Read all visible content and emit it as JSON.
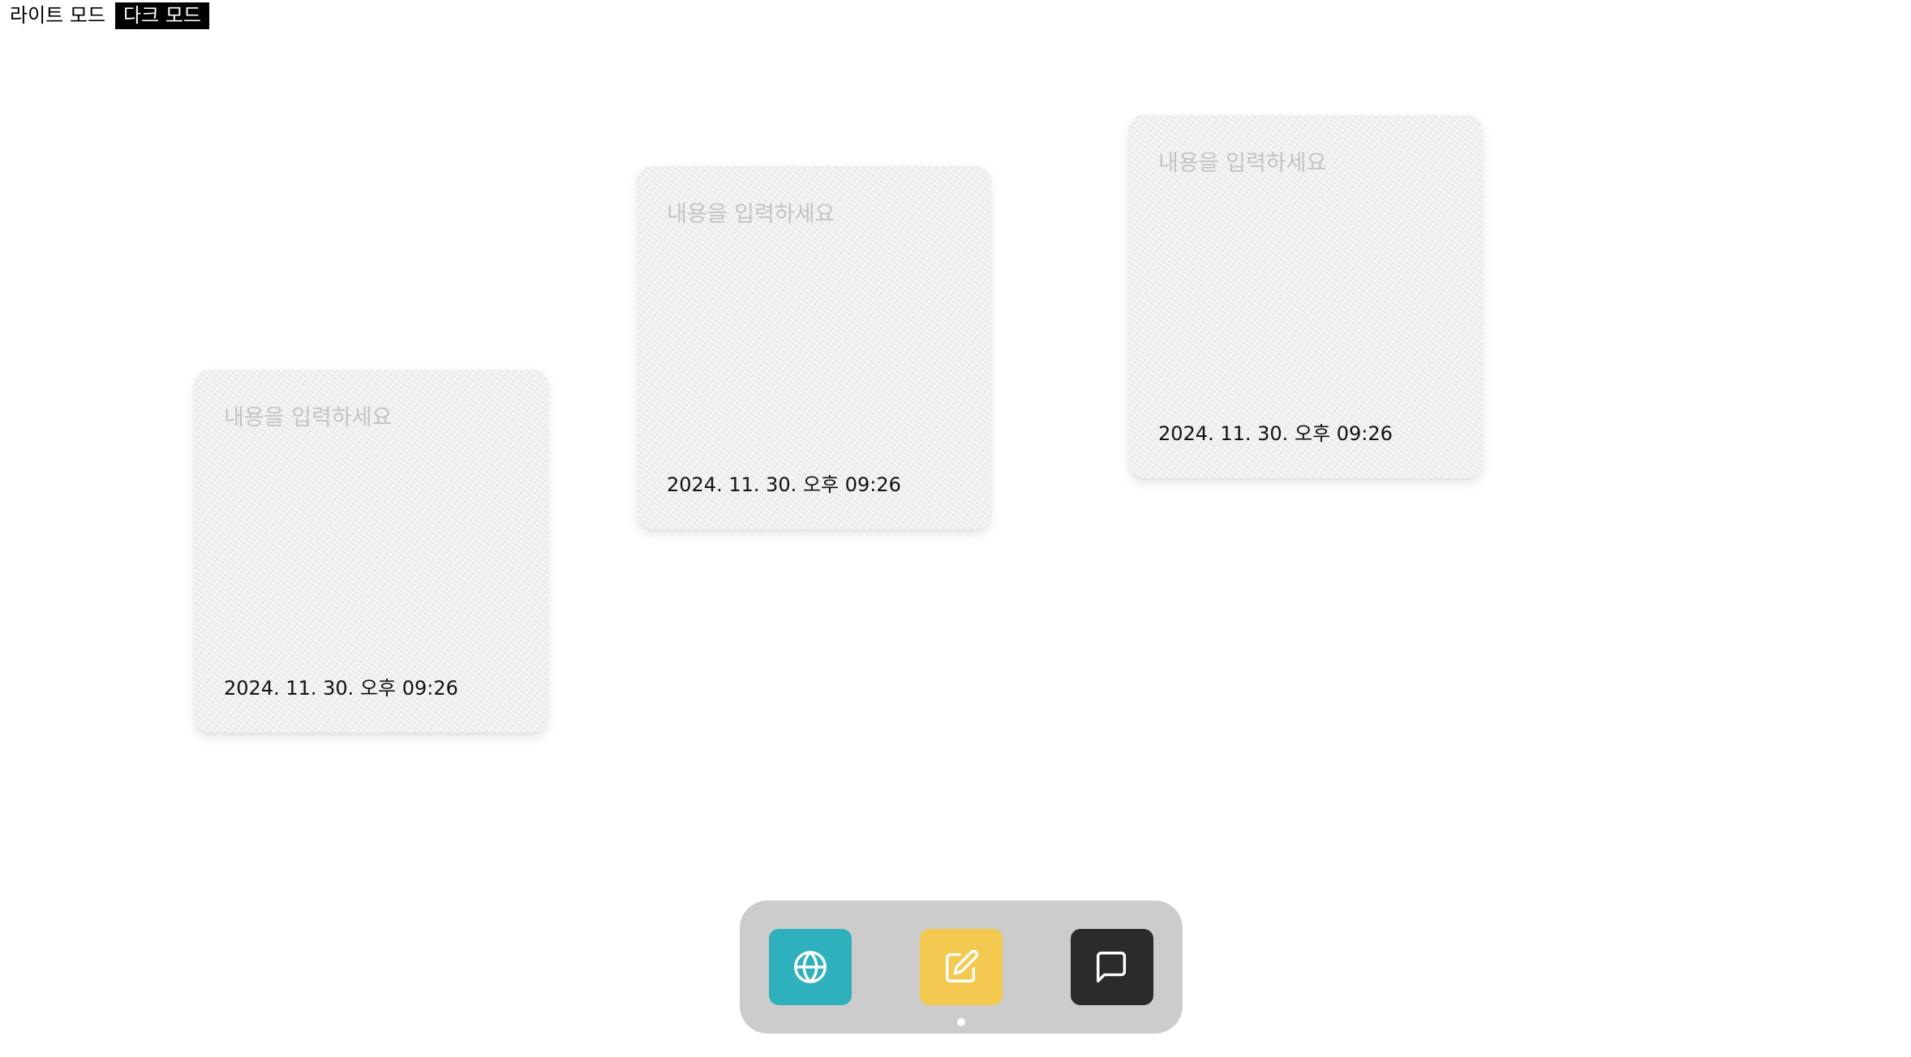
{
  "mode_switch": {
    "light_label": "라이트 모드",
    "dark_label": "다크 모드",
    "active": "dark"
  },
  "notes": [
    {
      "placeholder": "내용을 입력하세요",
      "value": "",
      "date": "2024. 11. 30. 오후 09:26"
    },
    {
      "placeholder": "내용을 입력하세요",
      "value": "",
      "date": "2024. 11. 30. 오후 09:26"
    },
    {
      "placeholder": "내용을 입력하세요",
      "value": "",
      "date": "2024. 11. 30. 오후 09:26"
    }
  ],
  "dock": {
    "apps": [
      {
        "icon": "globe-icon",
        "color": "#2eb0bd"
      },
      {
        "icon": "edit-icon",
        "color": "#f3c94f"
      },
      {
        "icon": "message-icon",
        "color": "#2b2b2b"
      }
    ],
    "active_indicator_under": "edit-icon"
  },
  "colors": {
    "background": "#ffffff",
    "note_background": "#f2f2f2",
    "dock_background": "#cccccc",
    "placeholder_text": "#c4c4c4"
  }
}
